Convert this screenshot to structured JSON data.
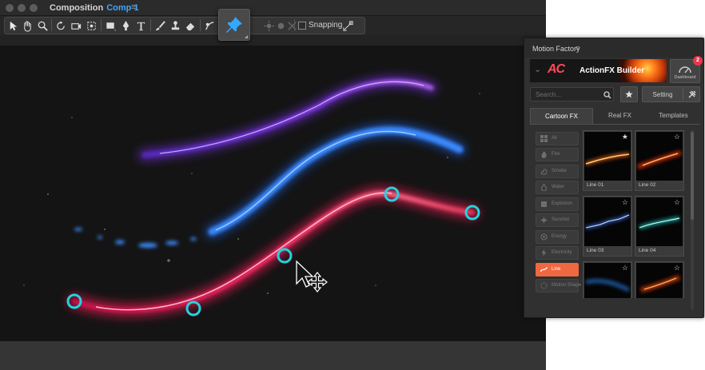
{
  "composition": {
    "title_prefix": "Composition",
    "title_comp": "Comp 1",
    "menu_glyph": "≡"
  },
  "toolbar": {
    "tools": [
      "selection-tool",
      "hand-tool",
      "zoom-tool",
      "rotate-tool",
      "orbit-camera-tool",
      "pan-behind-tool",
      "rectangle-tool",
      "pen-tool",
      "type-tool",
      "brush-tool",
      "clone-stamp-tool",
      "eraser-tool",
      "roto-brush-tool",
      "puppet-pin-tool"
    ],
    "snapping_label": "Snapping"
  },
  "panel": {
    "title": "Motion Factory",
    "menu_glyph": "≡",
    "banner": {
      "logo": "AC",
      "title": "ActionFX Builder"
    },
    "dashboard": {
      "label": "Dashboard",
      "badge": "2"
    },
    "search": {
      "placeholder": "Search..."
    },
    "setting_label": "Setting",
    "tabs": [
      {
        "label": "Cartoon FX",
        "active": true
      },
      {
        "label": "Real FX",
        "active": false
      },
      {
        "label": "Templates",
        "active": false
      }
    ],
    "categories": [
      {
        "label": "All",
        "icon": "grid-icon",
        "active": false
      },
      {
        "label": "Fire",
        "icon": "fire-icon",
        "active": false
      },
      {
        "label": "Smoke",
        "icon": "smoke-icon",
        "active": false
      },
      {
        "label": "Water",
        "icon": "water-icon",
        "active": false
      },
      {
        "label": "Explosion",
        "icon": "explosion-icon",
        "active": false
      },
      {
        "label": "Sunshot",
        "icon": "sunshot-icon",
        "active": false
      },
      {
        "label": "Energy",
        "icon": "energy-icon",
        "active": false
      },
      {
        "label": "Electricity",
        "icon": "electricity-icon",
        "active": false
      },
      {
        "label": "Line",
        "icon": "line-icon",
        "active": true
      },
      {
        "label": "Motion Shape",
        "icon": "motion-shape-icon",
        "active": false
      }
    ],
    "thumbnails": [
      {
        "label": "Line 01",
        "starred": true
      },
      {
        "label": "Line 02",
        "starred": false
      },
      {
        "label": "Line 03",
        "starred": false
      },
      {
        "label": "Line 04",
        "starred": false
      },
      {
        "label": "",
        "starred": false
      },
      {
        "label": "",
        "starred": false
      }
    ]
  },
  "colors": {
    "accent_orange": "#f0683f",
    "comp_blue": "#3ea6ff",
    "handle_cyan": "#22d3e0",
    "badge_red": "#e8374a"
  }
}
